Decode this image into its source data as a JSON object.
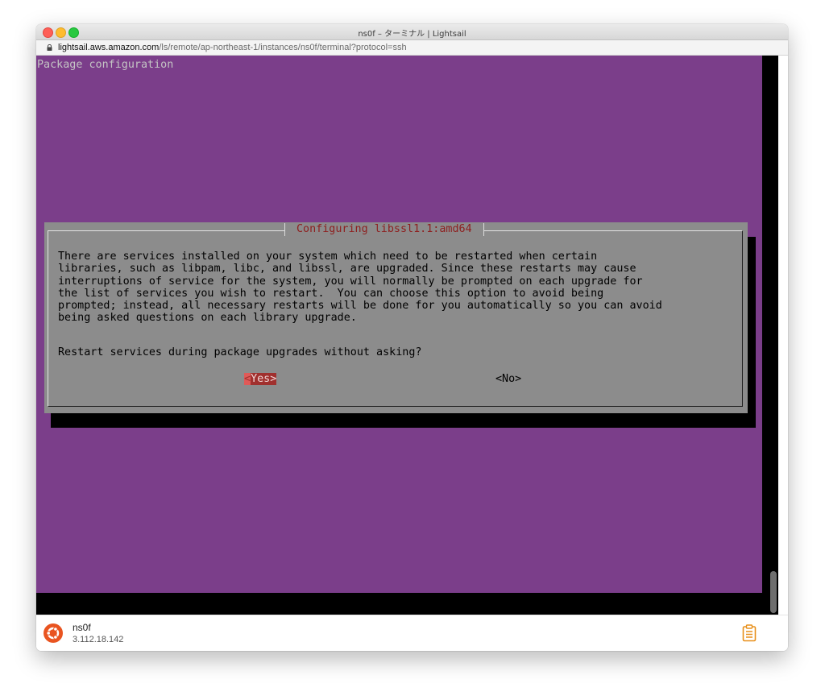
{
  "window": {
    "title": "ns0f – ターミナル | Lightsail"
  },
  "address": {
    "host": "lightsail.aws.amazon.com",
    "path": "/ls/remote/ap-northeast-1/instances/ns0f/terminal?protocol=ssh"
  },
  "terminal": {
    "heading": "Package configuration",
    "dialog": {
      "title": "Configuring libssl1.1:amd64",
      "body": "There are services installed on your system which need to be restarted when certain\nlibraries, such as libpam, libc, and libssl, are upgraded. Since these restarts may cause\ninterruptions of service for the system, you will normally be prompted on each upgrade for\nthe list of services you wish to restart.  You can choose this option to avoid being\nprompted; instead, all necessary restarts will be done for you automatically so you can avoid\nbeing asked questions on each library upgrade.",
      "question": "Restart services during package upgrades without asking?",
      "yes_cursor": "<",
      "yes_rest": "Yes>",
      "no_label": "<No>"
    }
  },
  "status": {
    "instance_name": "ns0f",
    "instance_ip": "3.112.18.142"
  },
  "colors": {
    "terminal_bg": "#7b3e8a",
    "dialog_bg": "#8c8c8c",
    "dialog_title": "#8e1f1f",
    "button_selected": "#a0302e",
    "ubuntu_orange": "#e95420",
    "clipboard_orange": "#e8901c"
  },
  "icons": {
    "lock": "lock-icon",
    "ubuntu": "ubuntu-icon",
    "clipboard": "clipboard-icon"
  }
}
